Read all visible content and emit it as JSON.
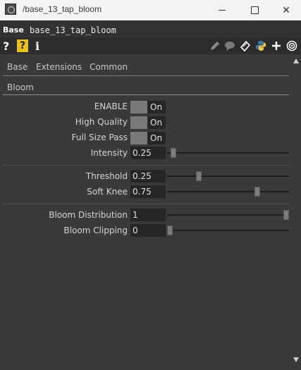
{
  "window": {
    "title": "/base_13_tap_bloom",
    "minimize": "minimize",
    "maximize": "maximize",
    "close": "✕"
  },
  "header": {
    "op_type": "Base",
    "op_name": "base_13_tap_bloom"
  },
  "toolbar": {
    "help": "?",
    "help_python": "?",
    "info": "i",
    "icons": [
      "pencil-icon",
      "comment-icon",
      "clone-icon",
      "python-icon",
      "plus-icon",
      "viewer-icon"
    ]
  },
  "tabs": [
    {
      "label": "Base"
    },
    {
      "label": "Extensions"
    },
    {
      "label": "Common"
    }
  ],
  "subtab": {
    "label": "Bloom"
  },
  "params": {
    "enable": {
      "label": "ENABLE",
      "value": "On"
    },
    "high_quality": {
      "label": "High Quality",
      "value": "On"
    },
    "full_size_pass": {
      "label": "Full Size Pass",
      "value": "On"
    },
    "intensity": {
      "label": "Intensity",
      "value": "0.25",
      "slider": 0.03
    },
    "threshold": {
      "label": "Threshold",
      "value": "0.25",
      "slider": 0.25
    },
    "soft_knee": {
      "label": "Soft Knee",
      "value": "0.75",
      "slider": 0.75
    },
    "bloom_distribution": {
      "label": "Bloom Distribution",
      "value": "1",
      "slider": 1.0
    },
    "bloom_clipping": {
      "label": "Bloom Clipping",
      "value": "0",
      "slider": 0.0
    }
  },
  "colors": {
    "panel_bg": "#3a3a3a",
    "field_bg": "#262626",
    "toggle_knob": "#7a7a7a",
    "help_badge": "#e8c020"
  }
}
